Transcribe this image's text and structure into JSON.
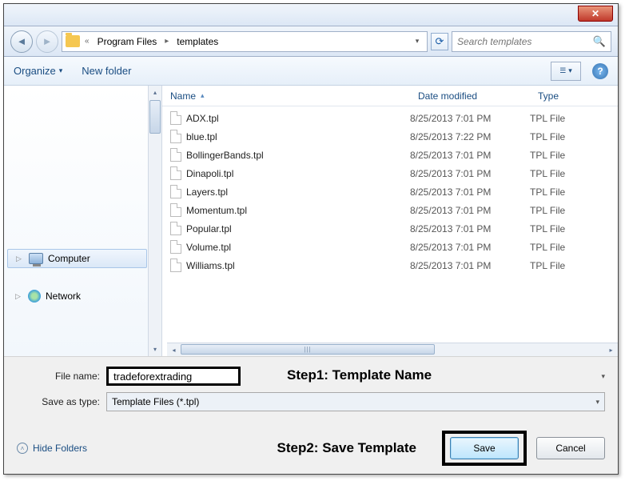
{
  "titlebar": {
    "close": "✕"
  },
  "address": {
    "sep": "«",
    "item1": "Program Files",
    "item2": "templates",
    "arrow": "▸",
    "dropdown": "▾",
    "refresh": "↻"
  },
  "search": {
    "placeholder": "Search templates",
    "icon": "🔍"
  },
  "toolbar": {
    "organize": "Organize",
    "newfolder": "New folder",
    "dd": "▾",
    "view_icon": "☰ ▾",
    "help": "?"
  },
  "tree": {
    "computer": "Computer",
    "network": "Network",
    "expand": "▷"
  },
  "columns": {
    "name": "Name",
    "date": "Date modified",
    "type": "Type",
    "sort": "▴"
  },
  "files": [
    {
      "name": "ADX.tpl",
      "date": "8/25/2013 7:01 PM",
      "type": "TPL File"
    },
    {
      "name": "blue.tpl",
      "date": "8/25/2013 7:22 PM",
      "type": "TPL File"
    },
    {
      "name": "BollingerBands.tpl",
      "date": "8/25/2013 7:01 PM",
      "type": "TPL File"
    },
    {
      "name": "Dinapoli.tpl",
      "date": "8/25/2013 7:01 PM",
      "type": "TPL File"
    },
    {
      "name": "Layers.tpl",
      "date": "8/25/2013 7:01 PM",
      "type": "TPL File"
    },
    {
      "name": "Momentum.tpl",
      "date": "8/25/2013 7:01 PM",
      "type": "TPL File"
    },
    {
      "name": "Popular.tpl",
      "date": "8/25/2013 7:01 PM",
      "type": "TPL File"
    },
    {
      "name": "Volume.tpl",
      "date": "8/25/2013 7:01 PM",
      "type": "TPL File"
    },
    {
      "name": "Williams.tpl",
      "date": "8/25/2013 7:01 PM",
      "type": "TPL File"
    }
  ],
  "form": {
    "filename_label": "File name:",
    "filename_value": "tradeforextrading",
    "saveas_label": "Save as type:",
    "saveas_value": "Template Files (*.tpl)"
  },
  "steps": {
    "step1": "Step1: Template Name",
    "step2": "Step2: Save Template"
  },
  "buttons": {
    "hide": "Hide Folders",
    "hide_icon": "˄",
    "save": "Save",
    "cancel": "Cancel"
  },
  "scroll": {
    "up": "▴",
    "down": "▾",
    "left": "◂",
    "right": "▸",
    "grip": "|||"
  }
}
